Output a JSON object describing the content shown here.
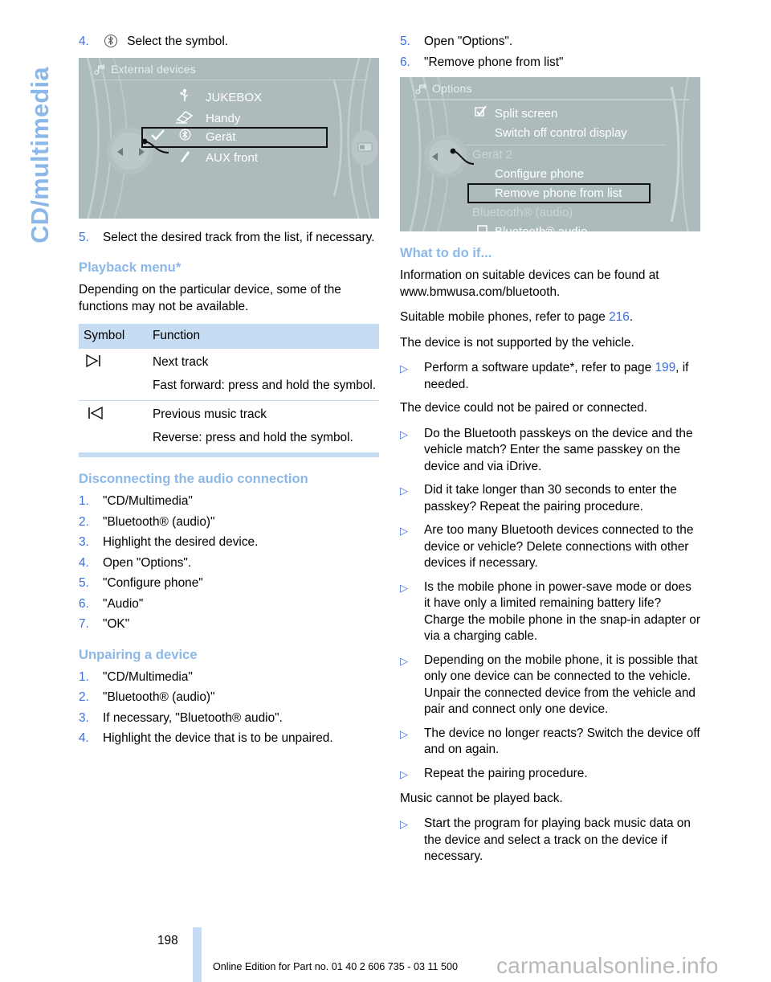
{
  "chapter_tab": {
    "label": "CD/multimedia"
  },
  "left_column": {
    "step4": {
      "num": "4.",
      "icon": "bluetooth-icon",
      "text": "Select the symbol."
    },
    "external_devices_screen": {
      "title": "External devices",
      "title_icon": "multimedia-note-icon",
      "items": [
        {
          "icon": "usb-icon",
          "label": "JUKEBOX",
          "selected": false,
          "checked": false
        },
        {
          "icon": "snapin-icon",
          "label": "Handy",
          "selected": false,
          "checked": false
        },
        {
          "icon": "bluetooth-icon",
          "label": "Gerät",
          "selected": true,
          "checked": true
        },
        {
          "icon": "aux-jack-icon",
          "label": "AUX front",
          "selected": false,
          "checked": false
        }
      ]
    },
    "step5": {
      "num": "5.",
      "text": "Select the desired track from the list, if necessary."
    },
    "playback_menu": {
      "heading": "Playback menu*",
      "intro": "Depending on the particular device, some of the functions may not be available.",
      "table": {
        "headers": [
          "Symbol",
          "Function"
        ],
        "rows": [
          {
            "symbol_icon": "next-track-icon",
            "lines": [
              "Next track",
              "Fast forward: press and hold the symbol."
            ]
          },
          {
            "symbol_icon": "previous-track-icon",
            "lines": [
              "Previous music track",
              "Reverse: press and hold the symbol."
            ]
          }
        ]
      }
    },
    "disconnecting": {
      "heading": "Disconnecting the audio connection",
      "steps": [
        {
          "num": "1.",
          "text": "\"CD/Multimedia\""
        },
        {
          "num": "2.",
          "text": "\"Bluetooth® (audio)\""
        },
        {
          "num": "3.",
          "text": "Highlight the desired device."
        },
        {
          "num": "4.",
          "text": "Open \"Options\"."
        },
        {
          "num": "5.",
          "text": "\"Configure phone\""
        },
        {
          "num": "6.",
          "text": "\"Audio\""
        },
        {
          "num": "7.",
          "text": "\"OK\""
        }
      ]
    },
    "unpairing": {
      "heading": "Unpairing a device",
      "steps": [
        {
          "num": "1.",
          "text": "\"CD/Multimedia\""
        },
        {
          "num": "2.",
          "text": "\"Bluetooth® (audio)\""
        },
        {
          "num": "3.",
          "text": "If necessary, \"Bluetooth® audio\"."
        },
        {
          "num": "4.",
          "text": "Highlight the device that is to be unpaired."
        }
      ]
    }
  },
  "right_column": {
    "steps": [
      {
        "num": "5.",
        "text": "Open \"Options\"."
      },
      {
        "num": "6.",
        "text": "\"Remove phone from list\""
      }
    ],
    "options_screen": {
      "title": "Options",
      "title_icon": "multimedia-note-icon",
      "items": [
        {
          "icon": "checkbox-checked-icon",
          "label": "Split screen",
          "type": "option",
          "selected": false
        },
        {
          "icon": "",
          "label": "Switch off control display",
          "type": "option",
          "selected": false
        },
        {
          "icon": "",
          "label": "Gerät 2",
          "type": "group",
          "selected": false
        },
        {
          "icon": "",
          "label": "Configure phone",
          "type": "option",
          "selected": false
        },
        {
          "icon": "",
          "label": "Remove phone from list",
          "type": "option",
          "selected": true
        },
        {
          "icon": "",
          "label": "Bluetooth® (audio)",
          "type": "group",
          "selected": false
        },
        {
          "icon": "checkbox-empty-icon",
          "label": "Bluetooth® audio",
          "type": "option",
          "selected": false
        }
      ]
    },
    "what_to_do": {
      "heading": "What to do if...",
      "intro1": "Information on suitable devices can be found at www.bmwusa.com/bluetooth.",
      "intro2_pre": "Suitable mobile phones, refer to page ",
      "intro2_page": "216",
      "intro2_post": ".",
      "case1": "The device is not supported by the vehicle.",
      "case1_item_pre": "Perform a software update*, refer to page ",
      "case1_item_page": "199",
      "case1_item_post": ", if needed.",
      "case2": "The device could not be paired or connected.",
      "case2_items": [
        "Do the Bluetooth passkeys on the device and the vehicle match? Enter the same passkey on the device and via iDrive.",
        "Did it take longer than 30 seconds to enter the passkey? Repeat the pairing procedure.",
        "Are too many Bluetooth devices connected to the device or vehicle? Delete connections with other devices if necessary.",
        "Is the mobile phone in power-save mode or does it have only a limited remaining battery life? Charge the mobile phone in the snap-in adapter or via a charging cable.",
        "Depending on the mobile phone, it is possible that only one device can be connected to the vehicle. Unpair the connected device from the vehicle and pair and connect only one device.",
        "The device no longer reacts? Switch the device off and on again.",
        "Repeat the pairing procedure."
      ],
      "case3": "Music cannot be played back.",
      "case3_items": [
        "Start the program for playing back music data on the device and select a track on the device if necessary."
      ]
    }
  },
  "footer": {
    "page_number": "198",
    "edition": "Online Edition for Part no. 01 40 2 606 735 - 03 11 500",
    "watermark": "carmanualsonline.info"
  },
  "colors": {
    "heading_blue": "#8cb8e8",
    "number_blue": "#3c6ee0",
    "table_header_blue": "#c6dcf2",
    "idrive_bg": "#adbbbd"
  }
}
